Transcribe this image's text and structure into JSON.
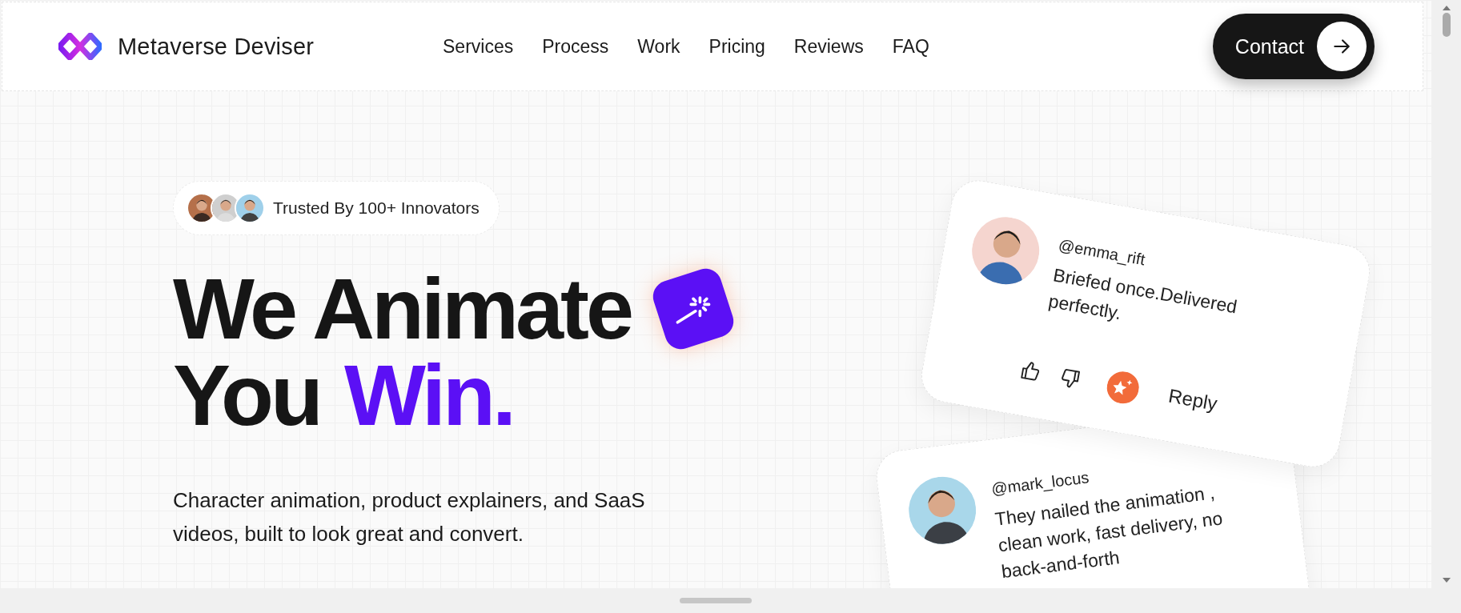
{
  "header": {
    "logo_text": "Metaverse Deviser",
    "nav": [
      {
        "label": "Services"
      },
      {
        "label": "Process"
      },
      {
        "label": "Work"
      },
      {
        "label": "Pricing"
      },
      {
        "label": "Reviews"
      },
      {
        "label": "FAQ"
      }
    ],
    "contact": "Contact"
  },
  "hero": {
    "badge": "Trusted By 100+ Innovators",
    "headline_line1": "We Animate",
    "headline_plain": "You",
    "headline_accent": "Win.",
    "subtitle": "Character animation, product explainers, and SaaS videos, built to look great and convert."
  },
  "testimonials": [
    {
      "handle": "@emma_rift",
      "text": "Briefed once.Delivered perfectly.",
      "reply": "Reply"
    },
    {
      "handle": "@mark_locus",
      "text": "They nailed the animation , clean work, fast delivery, no back-and-forth"
    }
  ]
}
